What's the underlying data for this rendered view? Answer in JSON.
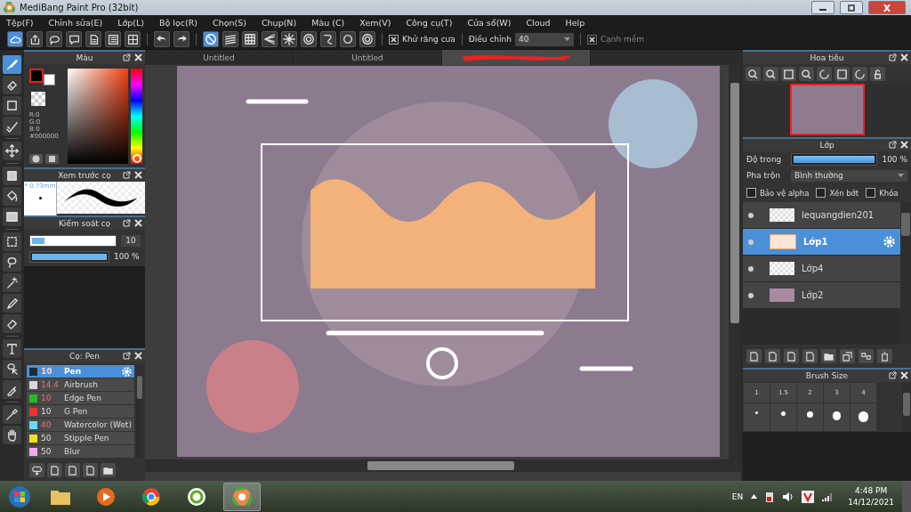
{
  "window": {
    "title": "MediBang Paint Pro (32bit)"
  },
  "menu": [
    "Tệp(F)",
    "Chỉnh sửa(E)",
    "Lớp(L)",
    "Bộ lọc(R)",
    "Chọn(S)",
    "Chụp(N)",
    "Màu (C)",
    "Xem(V)",
    "Công cụ(T)",
    "Cửa sổ(W)",
    "Cloud",
    "Help"
  ],
  "toolbar": {
    "snaps": [
      {
        "selected": true
      },
      {
        "selected": false
      },
      {
        "selected": false
      },
      {
        "selected": false
      },
      {
        "selected": false
      },
      {
        "selected": false
      },
      {
        "selected": false
      },
      {
        "selected": false
      },
      {
        "selected": false
      }
    ],
    "antialias": {
      "label": "Khử răng cưa",
      "checked": true
    },
    "adjust": {
      "label": "Điều chỉnh",
      "value": "40"
    },
    "soft_edge": {
      "label": "Cạnh mềm",
      "checked": true,
      "disabled": true
    }
  },
  "tools": [
    {
      "selected": true
    },
    {
      "selected": false
    },
    {
      "selected": false
    },
    {
      "selected": false
    },
    {
      "selected": false
    },
    {
      "selected": false
    },
    {
      "selected": false
    },
    {
      "selected": false
    },
    {
      "selected": false
    },
    {
      "selected": false
    },
    {
      "selected": false
    },
    {
      "selected": false
    },
    {
      "selected": false
    },
    {
      "selected": false
    },
    {
      "selected": false
    },
    {
      "selected": false
    },
    {
      "selected": false
    },
    {
      "selected": false
    }
  ],
  "document_tabs": [
    {
      "kind": "titled",
      "title": "Untitled",
      "selected": false
    },
    {
      "kind": "titled",
      "title": "Untitled",
      "selected": false
    },
    {
      "kind": "redacted",
      "selected": true
    }
  ],
  "color_panel": {
    "title": "Màu",
    "swatches": [
      {
        "color": "#000000"
      },
      {
        "color": "#ffffff"
      }
    ],
    "readout": [
      "R:0",
      "G:0",
      "B:0",
      "#000000"
    ],
    "hue": {
      "level": 0
    }
  },
  "brush_preview": {
    "title": "Xem trước cọ",
    "size": "* 0.73mm"
  },
  "brush_control": {
    "title": "Kiểm soát cọ",
    "size": {
      "level": 0.15,
      "reading": "10"
    },
    "opacity": {
      "level": 1,
      "reading": "100 %"
    }
  },
  "brushes": {
    "title": "Cọ: Pen",
    "items": [
      {
        "color": "#1e2a3a",
        "size": "10",
        "custom_size": true,
        "name": "Pen",
        "selected": true
      },
      {
        "color": "#d8d8d8",
        "size": "14.4",
        "custom_size": true,
        "name": "Airbrush",
        "selected": false
      },
      {
        "color": "#22bb22",
        "size": "10",
        "custom_size": true,
        "name": "Edge Pen",
        "selected": false
      },
      {
        "color": "#ee3333",
        "size": "10",
        "custom_size": false,
        "name": "G Pen",
        "selected": false
      },
      {
        "color": "#66ddf5",
        "size": "40",
        "custom_size": true,
        "name": "Watercolor (Wet)",
        "selected": false
      },
      {
        "color": "#f0e020",
        "size": "50",
        "custom_size": false,
        "name": "Stipple Pen",
        "selected": false
      },
      {
        "color": "#f4a8f4",
        "size": "50",
        "custom_size": false,
        "name": "Blur",
        "selected": false
      }
    ]
  },
  "navigator": {
    "title": "Hoa tiêu"
  },
  "layers": {
    "title": "Lớp",
    "opacity_label": "Độ trong",
    "opacity": {
      "level": 1,
      "reading": "100 %"
    },
    "blend_label": "Pha trộn",
    "blend": "Bình thường",
    "options": [
      {
        "label": "Bảo vệ alpha",
        "checked": false
      },
      {
        "label": "Xén bớt",
        "checked": false
      },
      {
        "label": "Khóa",
        "checked": false
      }
    ],
    "items": [
      {
        "name": "lequangdien201",
        "selected": false,
        "kind": "blank"
      },
      {
        "name": "Lớp1",
        "selected": true,
        "kind": "lettering"
      },
      {
        "name": "Lớp4",
        "selected": false,
        "kind": "blank"
      },
      {
        "name": "Lớp2",
        "selected": false,
        "kind": "photo"
      }
    ]
  },
  "brush_size": {
    "title": "Brush Size",
    "sizes": [
      "1",
      "1.5",
      "2",
      "3",
      "4"
    ]
  },
  "taskbar": {
    "language": "EN",
    "time": "4:48 PM",
    "date": "14/12/2021"
  }
}
